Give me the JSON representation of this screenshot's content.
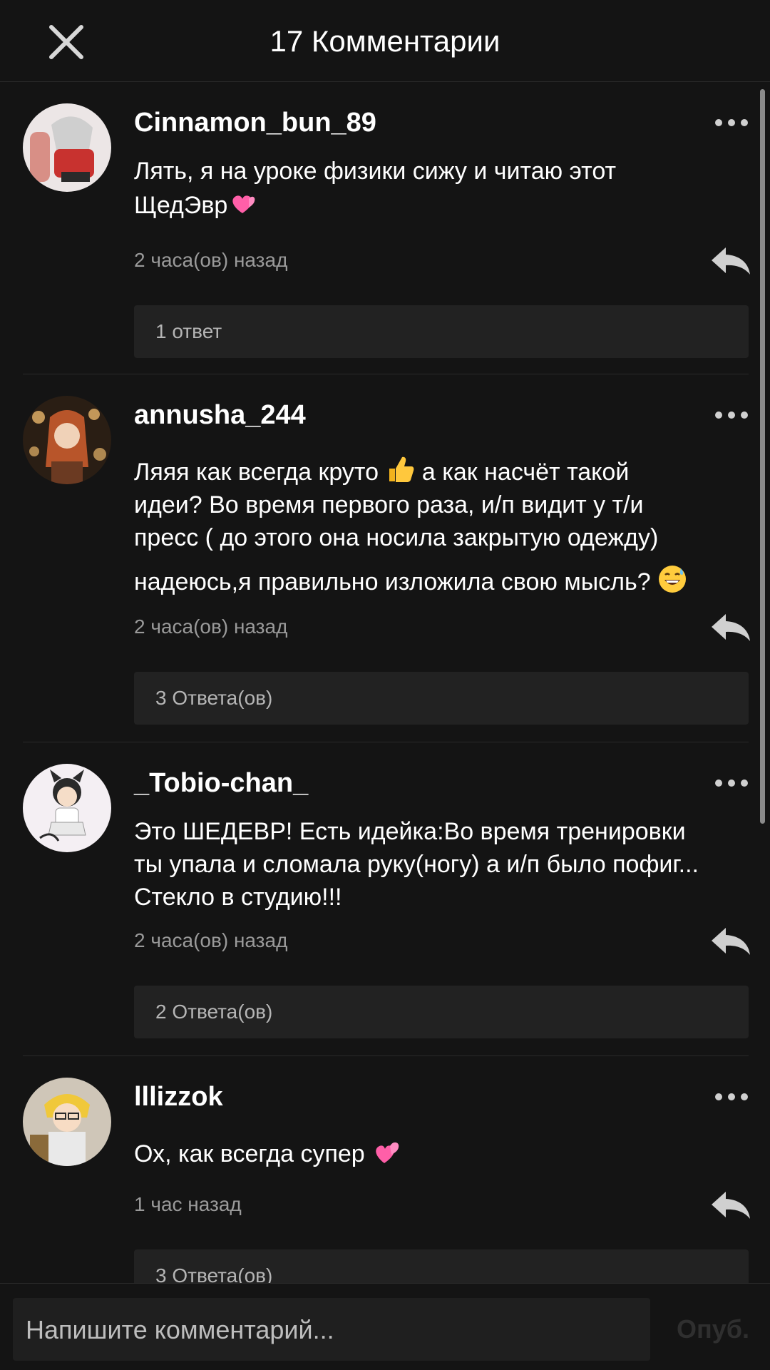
{
  "header": {
    "title": "17 Комментарии",
    "close_icon": "close-icon"
  },
  "comments": [
    {
      "username": "Cinnamon_bun_89",
      "lines": [
        "Лять, я на уроке физики сижу и читаю этот",
        "ЩедЭвр"
      ],
      "emoji": "two-hearts-emoji",
      "time": "2 часа(ов) назад",
      "replies": "1 ответ"
    },
    {
      "username": "annusha_244",
      "lines": [
        "Ляяя как всегда круто",
        "а как насчёт такой",
        "идеи? Во время первого раза, и/п видит у т/и",
        "пресс ( до этого она носила закрытую одежду)",
        "надеюсь,я правильно изложила свою мысль?"
      ],
      "emoji": "thumbs-up-emoji",
      "emoji2": "grinning-sweat-emoji",
      "time": "2 часа(ов) назад",
      "replies": "3 Ответа(ов)"
    },
    {
      "username": "_Tobio-chan_",
      "lines": [
        "Это ШЕДЕВР! Есть идейка:Во время тренировки",
        "ты упала и сломала руку(ногу) а и/п было пофиг...",
        "Стекло в студию!!!"
      ],
      "time": "2 часа(ов) назад",
      "replies": "2 Ответа(ов)"
    },
    {
      "username": "lllizzok",
      "lines": [
        "Ох, как всегда супер"
      ],
      "emoji": "two-hearts-emoji",
      "time": "1 час назад",
      "replies": "3 Ответа(ов)"
    }
  ],
  "icons": {
    "more": "more-dots-icon",
    "reply": "reply-arrow-icon"
  },
  "footer": {
    "placeholder": "Напишите комментарий...",
    "publish_label": "Опуб."
  }
}
